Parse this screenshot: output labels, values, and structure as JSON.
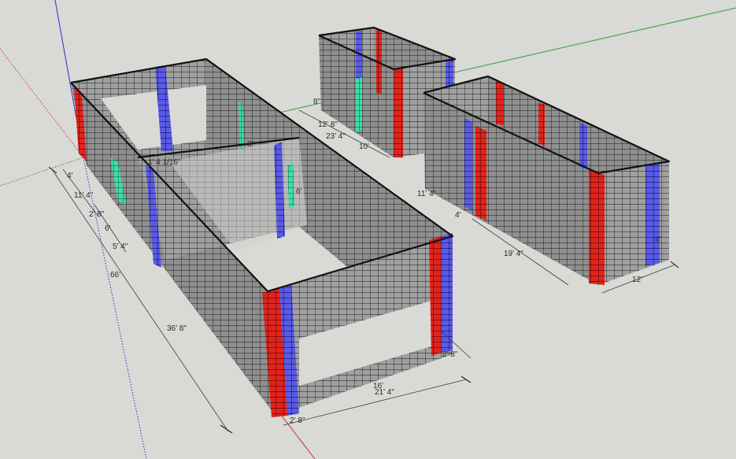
{
  "colors": {
    "background": "#d9d9d6",
    "wall_fill": "#8f8f8f",
    "wall_face_light": "#a3a3a3",
    "wall_face_dark": "#7d7d7d",
    "block_grid": "#1a1a1a",
    "column_red": "#e0241c",
    "column_blue": "#5a5ae6",
    "column_green": "#3ee0a8",
    "axis_red": "#c83232",
    "axis_green": "#2ea02e",
    "axis_blue": "#2e2ec8"
  },
  "icons": [
    "axis-origin-icon"
  ],
  "dimensions": {
    "building1": {
      "d_4": "4'",
      "d_11_4": "11' 4\"",
      "d_2_8_a": "2' 8\"",
      "d_6_a": "6'",
      "d_5_4": "5' 4\"",
      "d_66": "66'",
      "d_36_8": "36' 8\"",
      "d_1_4_1_16": "1' 4 1/16\"",
      "d_8": "8\"",
      "d_6_b": "6'",
      "d_16": "16'",
      "d_21_4": "21' 4\"",
      "d_2_8_b": "2' 8\"",
      "d_2_8_c": "2' 8\""
    },
    "building2": {
      "d_8": "8\"",
      "d_12_8": "12' 8\"",
      "d_23_4": "23' 4\"",
      "d_10": "10'"
    },
    "building3": {
      "d_11_4": "11' 4\"",
      "d_4": "4'",
      "d_19_4": "19' 4\"",
      "d_4in": "4\"",
      "d_12": "12'"
    }
  }
}
